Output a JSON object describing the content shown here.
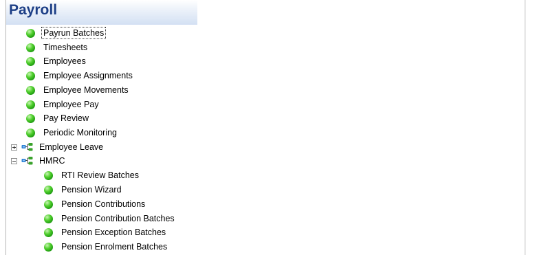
{
  "header": {
    "title": "Payroll"
  },
  "tree": {
    "items": [
      {
        "label": "Payrun Batches"
      },
      {
        "label": "Timesheets"
      },
      {
        "label": "Employees"
      },
      {
        "label": "Employee Assignments"
      },
      {
        "label": "Employee Movements"
      },
      {
        "label": "Employee Pay"
      },
      {
        "label": "Pay Review"
      },
      {
        "label": "Periodic Monitoring"
      }
    ],
    "groups": [
      {
        "label": "Employee Leave",
        "state": "collapsed"
      },
      {
        "label": "HMRC",
        "state": "expanded"
      }
    ],
    "hmrc_children": [
      {
        "label": "RTI Review Batches"
      },
      {
        "label": "Pension Wizard"
      },
      {
        "label": "Pension Contributions"
      },
      {
        "label": "Pension Contribution Batches"
      },
      {
        "label": "Pension Exception Batches"
      },
      {
        "label": "Pension Enrolment Batches"
      }
    ],
    "selected_item": "Payrun Batches"
  },
  "colors": {
    "title": "#1d3f86",
    "bullet": "#3cba1e",
    "folder": "#2a7fd4",
    "folder_node": "#3aa22c"
  },
  "icons": {
    "item": "green-bullet-icon",
    "group": "hierarchy-icon",
    "collapsed": "plus-box-icon",
    "expanded": "minus-box-icon"
  }
}
